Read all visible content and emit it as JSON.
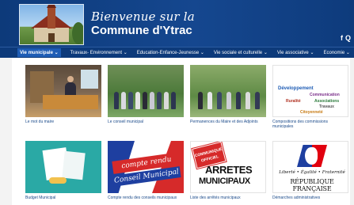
{
  "header": {
    "title_line1": "Bienvenue sur la",
    "title_line2": "Commune d'Ytrac",
    "social_icons": [
      "facebook-icon",
      "search-icon"
    ],
    "social_glyphs": [
      "f",
      "Q"
    ]
  },
  "nav": {
    "items": [
      {
        "label": "Vie municipale",
        "active": true
      },
      {
        "label": "Travaux- Environnement",
        "active": false
      },
      {
        "label": "Education-Enfance-Jeunesse",
        "active": false
      },
      {
        "label": "Vie sociale et culturelle",
        "active": false
      },
      {
        "label": "Vie associative",
        "active": false
      },
      {
        "label": "Economie",
        "active": false
      }
    ],
    "caret": "⌄"
  },
  "cards": [
    {
      "caption": "Le mot du maire"
    },
    {
      "caption": "Le conseil municipal"
    },
    {
      "caption": "Permanences du Maire et des Adjoints"
    },
    {
      "caption": "Compositions des commissions municipales"
    },
    {
      "caption": "Budget Municipal"
    },
    {
      "caption": "Compte rendu des conseils municipaux"
    },
    {
      "caption": "Liste des arrêtés municipaux"
    },
    {
      "caption": "Démarches administratives"
    }
  ],
  "thumbnails": {
    "commissions_words": [
      "Développement",
      "Communication",
      "Ruralité",
      "Associations",
      "Travaux",
      "Citoyenneté"
    ],
    "compte_rendu": {
      "line1": "compte rendu",
      "line2": "Conseil Municipal"
    },
    "arretes": {
      "stamp": "COMMUNIQUÉ OFFICIEL",
      "line1": "ARRETES",
      "line2": "MUNICIPAUX"
    },
    "republique": {
      "motto": "Liberté • Égalité • Fraternité",
      "name": "RÉPUBLIQUE FRANÇAISE"
    }
  },
  "colors": {
    "header_blue": "#15478f",
    "nav_blue": "#0d3a7a",
    "active_nav": "#1f5db5",
    "caption_blue": "#1a4a8a"
  }
}
